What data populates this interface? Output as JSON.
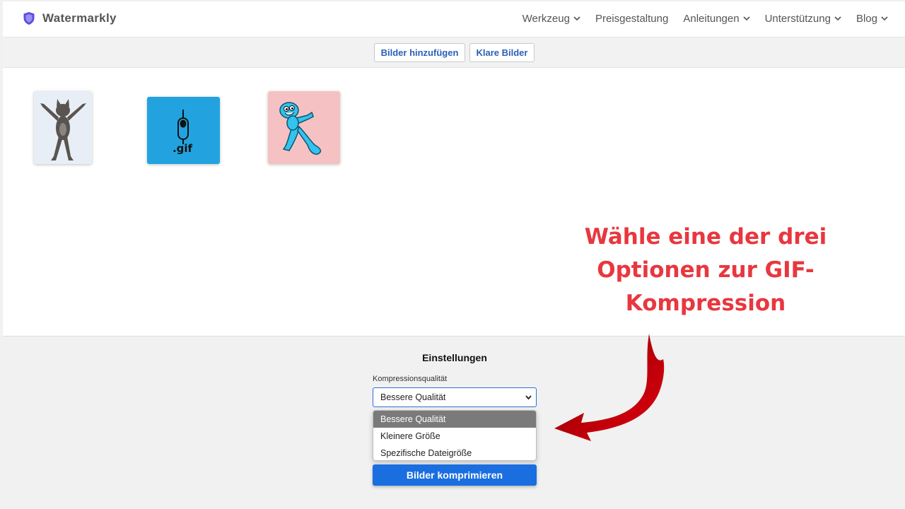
{
  "header": {
    "brand": "Watermarkly",
    "nav": [
      {
        "label": "Werkzeug",
        "has_dropdown": true
      },
      {
        "label": "Preisgestaltung",
        "has_dropdown": false
      },
      {
        "label": "Anleitungen",
        "has_dropdown": true
      },
      {
        "label": "Unterstützung",
        "has_dropdown": true
      },
      {
        "label": "Blog",
        "has_dropdown": true
      }
    ]
  },
  "toolbar": {
    "add_label": "Bilder hinzufügen",
    "clear_label": "Klare Bilder"
  },
  "canvas": {
    "thumbnails": [
      {
        "name": "dancing-cat",
        "bg": "#e8eef6"
      },
      {
        "name": "gif-icon",
        "bg": "#22a3e0",
        "text": ".gif"
      },
      {
        "name": "blue-cartoon",
        "bg": "#f6c1c3"
      }
    ],
    "annotation": "Wähle eine der drei Optionen zur GIF-Kompression"
  },
  "settings": {
    "title": "Einstellungen",
    "quality_label": "Kompressionsqualität",
    "quality_value": "Bessere Qualität",
    "options": [
      "Bessere Qualität",
      "Kleinere Größe",
      "Spezifische Dateigröße"
    ],
    "compress_label": "Bilder komprimieren"
  },
  "colors": {
    "accent": "#1a6ee0",
    "annotation": "#e8373f",
    "arrow": "#c4000a",
    "brand_shield": "#5b4ee0"
  }
}
